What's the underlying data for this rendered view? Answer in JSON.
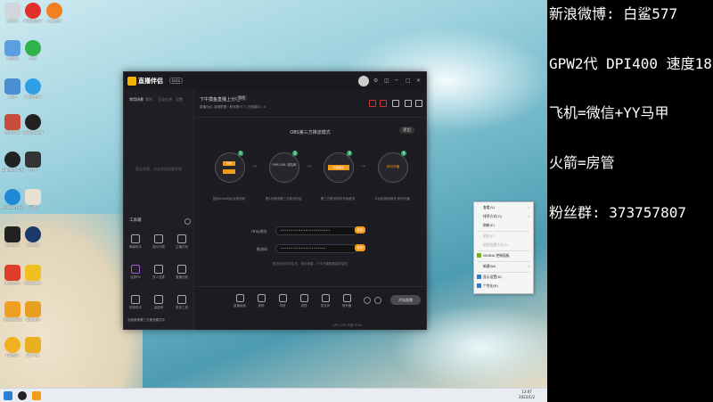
{
  "desktop": {
    "icons_col1": [
      "回收站",
      "此电脑",
      "网络",
      "控制面板",
      "Logitech G HUB",
      "Microsoft Edge",
      "Foxmail",
      "腾讯会议",
      "夜神模拟器",
      "QQ音乐",
      "腾讯QQ"
    ],
    "icons_col2": [
      "网易云音乐",
      "微信",
      "腾讯视频",
      "OBS Studio",
      "优酷",
      "迅雷",
      "直播伴侣",
      "Steam",
      "WeGame",
      "英雄联盟",
      "QQ飞车"
    ],
    "icons_top3": "小米助手"
  },
  "right_panel": {
    "line1": "新浪微博: 白鲨577",
    "line2": "GPW2代 DPI400 速度18",
    "line3": "飞机=微信+YY马甲",
    "line4": "火箭=房管",
    "line5": "粉丝群: 373757807"
  },
  "app": {
    "name": "直播伴侣",
    "version": "beta",
    "win_controls": [
      "⚙",
      "◫",
      "─",
      "□",
      "✕"
    ],
    "sidebar_tabs": [
      "常用场景",
      "素材",
      "互动礼物",
      "设置"
    ],
    "sidebar_empty": "暂无场景，点击添加场景开始",
    "tools_title": "工具箱",
    "tools": [
      "弹幕助手",
      "观众列表",
      "主播任务",
      "连麦PK",
      "多人连麦",
      "直播回放",
      "语音助手",
      "高能榜",
      "更多工具"
    ],
    "side_footer": "当前使用第三方推流模式中",
    "room_title": "下午摸鱼直播上分啦",
    "room_tag": "游戏",
    "room_meta": "直播分区: 英雄联盟 | 粉丝数577 | 在线观众 | 0",
    "mode_title": "OBS第三方推流模式",
    "exit_label": "退出",
    "steps": [
      {
        "num": "1",
        "label": "复制rtmp地址及推流码",
        "inner": "复制"
      },
      {
        "num": "2",
        "label": "第1次使用第三方推流的话",
        "inner": "FMS URL 流名称"
      },
      {
        "num": "3",
        "label": "第三方推流软件开始推流",
        "inner": "开始推流"
      },
      {
        "num": "4",
        "label": "平台检测到推流 即可开播",
        "inner": "即可开播"
      }
    ],
    "rtmp_label": "rtmp地址",
    "rtmp_value": "••••••••••••••••••••••••",
    "key_label": "推流码",
    "key_value": "••••••••••••••••••••••",
    "copy_label": "复制",
    "field_hint": "推流码仅本机生效，请勿泄露，下次开播需要重新复制",
    "bottom_buttons": [
      "直播画面",
      "美颜",
      "特效",
      "滤镜",
      "麦克风",
      "扬声器"
    ],
    "live_label": "开始直播",
    "status": "CPU 12%  内存 55%"
  },
  "context_menu": {
    "items": [
      {
        "label": "查看(V)",
        "disabled": false,
        "arrow": true
      },
      {
        "label": "排序方式(O)",
        "disabled": false,
        "arrow": true
      },
      {
        "label": "刷新(E)",
        "disabled": false,
        "arrow": false
      },
      {
        "label": "粘贴(P)",
        "disabled": true,
        "arrow": false
      },
      {
        "label": "粘贴快捷方式(S)",
        "disabled": true,
        "arrow": false
      },
      {
        "label": "NVIDIA 控制面板",
        "disabled": false,
        "arrow": false
      },
      {
        "label": "新建(W)",
        "disabled": false,
        "arrow": true
      },
      {
        "label": "显示设置(D)",
        "disabled": false,
        "arrow": false
      },
      {
        "label": "个性化(R)",
        "disabled": false,
        "arrow": false
      }
    ]
  },
  "taskbar": {
    "time": "13:07",
    "date": "2022/1/2"
  },
  "colors": {
    "accent_orange": "#f59b1a",
    "step_green": "#2fae6b",
    "app_bg": "#1c1c22"
  }
}
